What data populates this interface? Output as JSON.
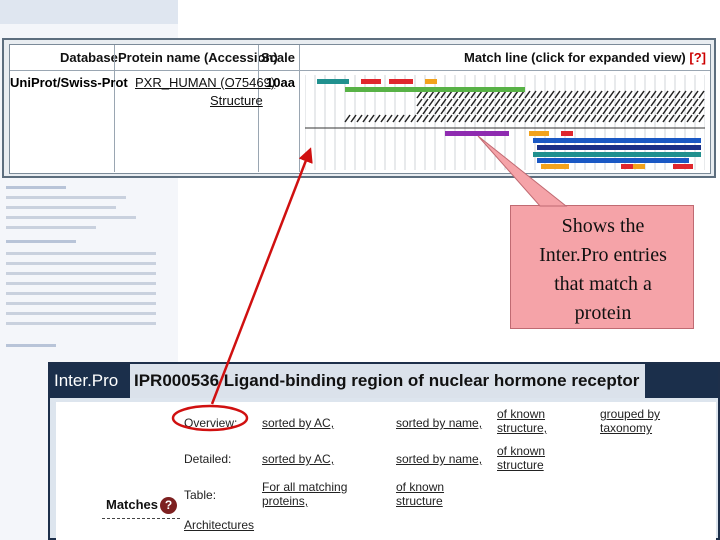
{
  "header": {
    "database": "Database",
    "protein_name": "Protein name (Accession)",
    "scale": "Scale",
    "match_line": "Match line (click for expanded view)",
    "help_q": "[?]"
  },
  "entry_row": {
    "database": "UniProt/Swiss-Prot",
    "protein_link": "PXR_HUMAN (O75469)",
    "structure_link": "Structure",
    "scale": "10aa"
  },
  "colors": {
    "teal": "#20908e",
    "red": "#e0262d",
    "orange": "#f2a21c",
    "green": "#58b246",
    "purple": "#8e2bb0",
    "blue": "#1a58c4",
    "darkblue": "#1a2f87",
    "yellow": "#d9d71c"
  },
  "match_bars": [
    {
      "color": "teal",
      "start": 0.03,
      "end": 0.11,
      "row": 0
    },
    {
      "color": "red",
      "start": 0.14,
      "end": 0.19,
      "row": 0
    },
    {
      "color": "red",
      "start": 0.21,
      "end": 0.27,
      "row": 0
    },
    {
      "color": "orange",
      "start": 0.3,
      "end": 0.33,
      "row": 0
    },
    {
      "color": "green",
      "start": 0.1,
      "end": 0.55,
      "row": 1
    },
    {
      "color": "purple",
      "start": 0.35,
      "end": 0.51,
      "row": 7
    },
    {
      "color": "orange",
      "start": 0.56,
      "end": 0.61,
      "row": 7
    },
    {
      "color": "red",
      "start": 0.64,
      "end": 0.67,
      "row": 7
    },
    {
      "color": "blue",
      "start": 0.57,
      "end": 0.99,
      "row": 8
    },
    {
      "color": "darkblue",
      "start": 0.58,
      "end": 0.99,
      "row": 9
    },
    {
      "color": "teal",
      "start": 0.57,
      "end": 0.99,
      "row": 10
    },
    {
      "color": "blue",
      "start": 0.58,
      "end": 0.96,
      "row": 11
    },
    {
      "color": "orange",
      "start": 0.59,
      "end": 0.66,
      "row": 12
    },
    {
      "color": "red",
      "start": 0.79,
      "end": 0.83,
      "row": 12
    },
    {
      "color": "red",
      "start": 0.92,
      "end": 0.97,
      "row": 12
    },
    {
      "color": "red",
      "start": 0.8,
      "end": 0.83,
      "row": 13
    },
    {
      "color": "orange",
      "start": 0.82,
      "end": 0.85,
      "row": 13
    },
    {
      "color": "red",
      "start": 0.93,
      "end": 0.96,
      "row": 13
    }
  ],
  "callout": {
    "lines": [
      "Shows the",
      "Inter.Pro entries",
      "that match a",
      "protein"
    ]
  },
  "interpro": {
    "tag": "Inter.Pro",
    "id_title": "IPR000536 Ligand-binding region of nuclear hormone receptor",
    "matches_label": "Matches",
    "help_glyph": "?",
    "overview": {
      "label": "Overview:",
      "sorted_ac": "sorted by AC,",
      "sorted_name": "sorted by name,",
      "known_1": "of known",
      "known_2": "structure,",
      "grouped_1": "grouped by",
      "grouped_2": "taxonomy"
    },
    "detailed": {
      "label": "Detailed:",
      "sorted_ac": "sorted by AC,",
      "sorted_name": "sorted by name,",
      "known_1": "of known",
      "known_2": "structure"
    },
    "table": {
      "label": "Table:",
      "all_1": "For all matching",
      "all_2": "proteins,",
      "known_1": "of known",
      "known_2": "structure"
    },
    "architectures": "Architectures"
  }
}
